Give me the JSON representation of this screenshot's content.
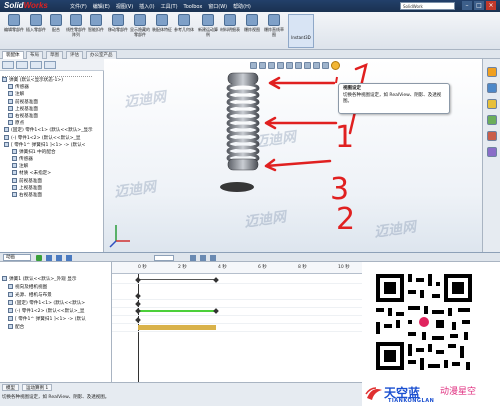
{
  "window": {
    "app_name_part1": "Solid",
    "app_name_part2": "Works",
    "menu": [
      "文件(F)",
      "编辑(E)",
      "视图(V)",
      "插入(I)",
      "工具(T)",
      "Toolbox",
      "窗口(W)",
      "帮助(H)"
    ],
    "search_placeholder": "SolidWork"
  },
  "toolbar": {
    "tools": [
      "编辑零部件",
      "插入零部件",
      "配合",
      "线性零部件阵列",
      "智能扣件",
      "移动零部件",
      "显示隐藏的零部件",
      "装配体特征",
      "参考几何体",
      "新建运动算例",
      "材料明细表",
      "爆炸视图",
      "爆炸直线草图",
      "干涉检查"
    ],
    "instant3d_label": "Instant3D"
  },
  "tabs": [
    "装配体",
    "布局",
    "草图",
    "评估",
    "办公室产品"
  ],
  "tree": {
    "root": "弹簧 (默认<显示状态-1>)",
    "items": [
      "传感器",
      "注解",
      "前视基准面",
      "上视基准面",
      "右视基准面",
      "原点",
      "(固定) 零件1<1> (默认<<默认>_显示",
      "(-) 零件1<2> (默认<<默认>_显",
      "[ 零件1^ 弹簧扫1 ]<1> -> (默认<",
      "弹簧扫1 中的配合",
      "传感器",
      "注解",
      "材质 <未指定>",
      "前视基准面",
      "上视基准面",
      "右视基准面"
    ]
  },
  "viewport_tooltip": {
    "title": "视图设定",
    "body": "切换各种视图设定，如 RealView、阴影、及透视图。"
  },
  "annotations": [
    "1",
    "3",
    "2"
  ],
  "watermark": "迈迪网",
  "motion": {
    "study_type": "动画",
    "ruler_ticks": [
      "0 秒",
      "2 秒",
      "4 秒",
      "6 秒",
      "8 秒",
      "10 秒"
    ],
    "tree_items": [
      "弹簧1 (默认<<默认>_外观 显示",
      "视向及相机视图",
      "光源、相机与布景",
      "(固定) 零件1<1> (默认<<默认>",
      "(-) 零件1<2> (默认<<默认>_显",
      "[ 零件1^ 弹簧扫1 ]<1> -> (默认",
      "配合"
    ]
  },
  "bottom_tabs": [
    "模型",
    "运动算例 1"
  ],
  "status_text": "切换各种视图设定，如 RealView、阴影、及透视图。",
  "brand": {
    "name_cn": "天空蓝",
    "tagline_cn": "动漫星空",
    "name_en": "TIANKONGLAN"
  },
  "colors": {
    "title_bar": "#1a3150",
    "accent_red": "#e02020",
    "timeline_green": "#4cd03a",
    "timeline_gold": "#d9b24a"
  }
}
